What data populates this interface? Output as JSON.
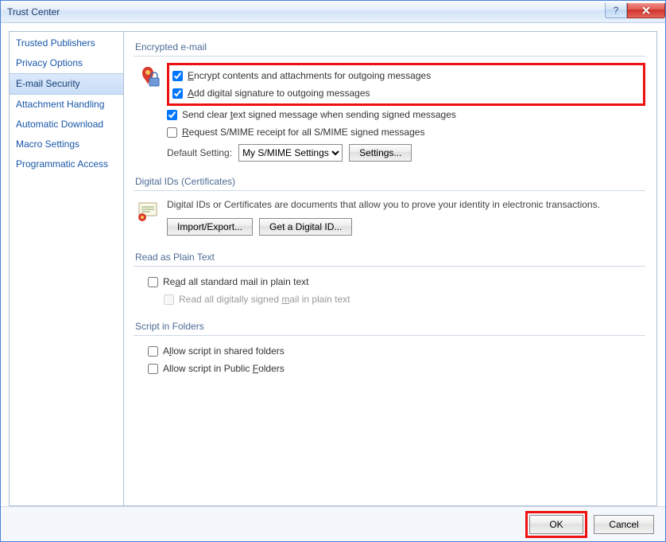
{
  "window": {
    "title": "Trust Center"
  },
  "titlebar_buttons": {
    "help_tip": "Help",
    "close_tip": "Close"
  },
  "sidebar": {
    "items": [
      {
        "label": "Trusted Publishers"
      },
      {
        "label": "Privacy Options"
      },
      {
        "label": "E-mail Security",
        "selected": true
      },
      {
        "label": "Attachment Handling"
      },
      {
        "label": "Automatic Download"
      },
      {
        "label": "Macro Settings"
      },
      {
        "label": "Programmatic Access"
      }
    ]
  },
  "sections": {
    "encrypted": {
      "title": "Encrypted e-mail",
      "checkboxes": {
        "encrypt": "Encrypt contents and attachments for outgoing messages",
        "sign": "Add digital signature to outgoing messages",
        "cleartext": "Send clear text signed message when sending signed messages",
        "receipt": "Request S/MIME receipt for all S/MIME signed messages"
      },
      "default_setting_label": "Default Setting:",
      "default_setting_value": "My S/MIME Settings",
      "settings_btn": "Settings..."
    },
    "digital_ids": {
      "title": "Digital IDs (Certificates)",
      "desc": "Digital IDs or Certificates are documents that allow you to prove your identity in electronic transactions.",
      "import_btn": "Import/Export...",
      "get_btn": "Get a Digital ID..."
    },
    "plain_text": {
      "title": "Read as Plain Text",
      "read_all": "Read all standard mail in plain text",
      "read_signed": "Read all digitally signed mail in plain text"
    },
    "script": {
      "title": "Script in Folders",
      "shared": "Allow script in shared folders",
      "public": "Allow script in Public Folders"
    }
  },
  "footer": {
    "ok": "OK",
    "cancel": "Cancel"
  }
}
